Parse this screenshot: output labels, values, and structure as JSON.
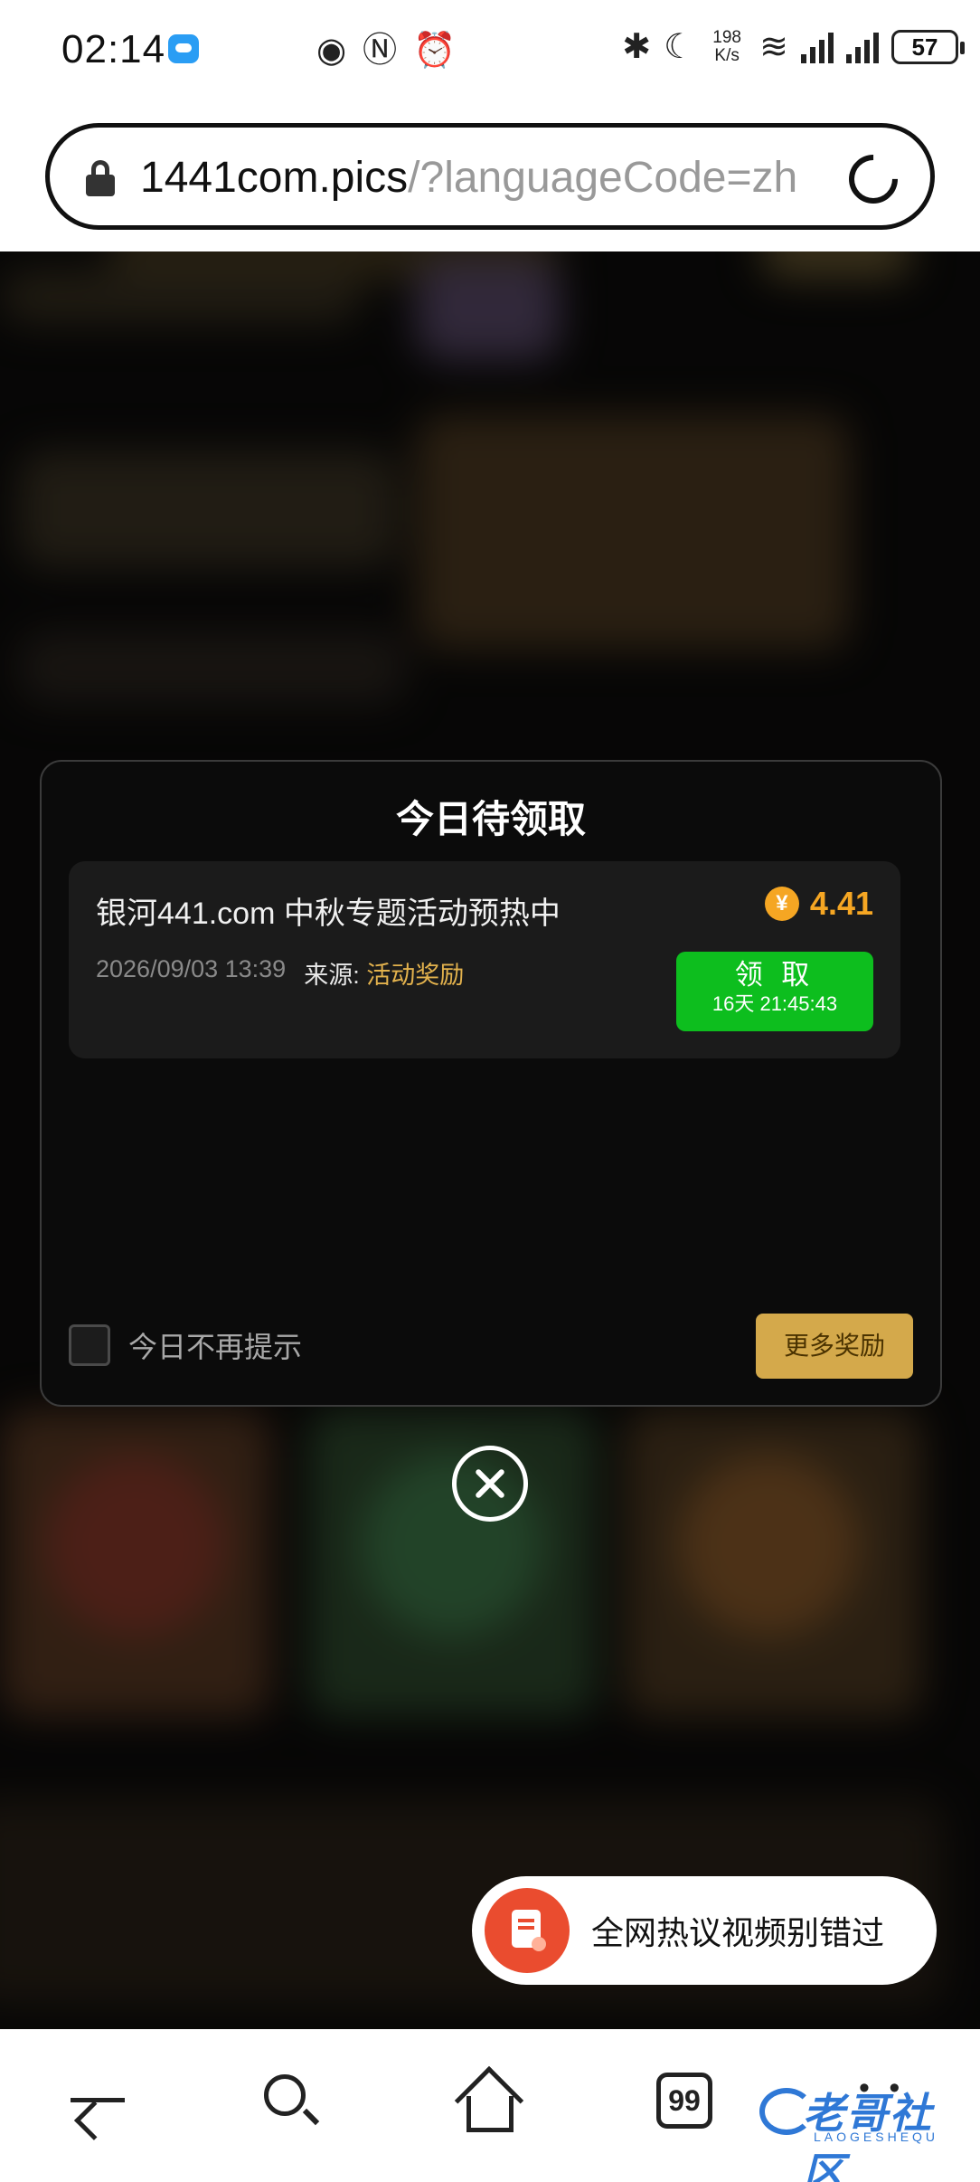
{
  "status_bar": {
    "time": "02:14",
    "net_speed_value": "198",
    "net_speed_unit": "K/s",
    "battery": "57",
    "icons": [
      "message-icon",
      "eye-icon",
      "nfc-icon",
      "alarm-icon",
      "bluetooth-icon",
      "vibrate-icon",
      "moon-icon",
      "wifi-icon",
      "signal-icon",
      "signal-icon"
    ]
  },
  "browser": {
    "url_host": "1441com.pics",
    "url_path": "/?languageCode=zh"
  },
  "modal": {
    "title": "今日待领取",
    "reward": {
      "title": "银河441.com 中秋专题活动预热中",
      "coin_symbol": "¥",
      "amount": "4.41",
      "date": "2026/09/03 13:39",
      "source_label": "来源:",
      "source_value": "活动奖励",
      "claim_label": "领 取",
      "claim_timer": "16天 21:45:43"
    },
    "no_remind_label": "今日不再提示",
    "more_rewards_label": "更多奖励"
  },
  "toast": {
    "text": "全网热议视频别错过"
  },
  "bottom_nav": {
    "tabs_count": "99"
  },
  "watermark": {
    "text": "老哥社区",
    "sub": "LAOGESHEQU"
  },
  "colors": {
    "accent_green": "#0dbe1e",
    "accent_gold": "#d4a94b",
    "amount_orange": "#f5a623",
    "toast_red": "#ea4c2f"
  }
}
